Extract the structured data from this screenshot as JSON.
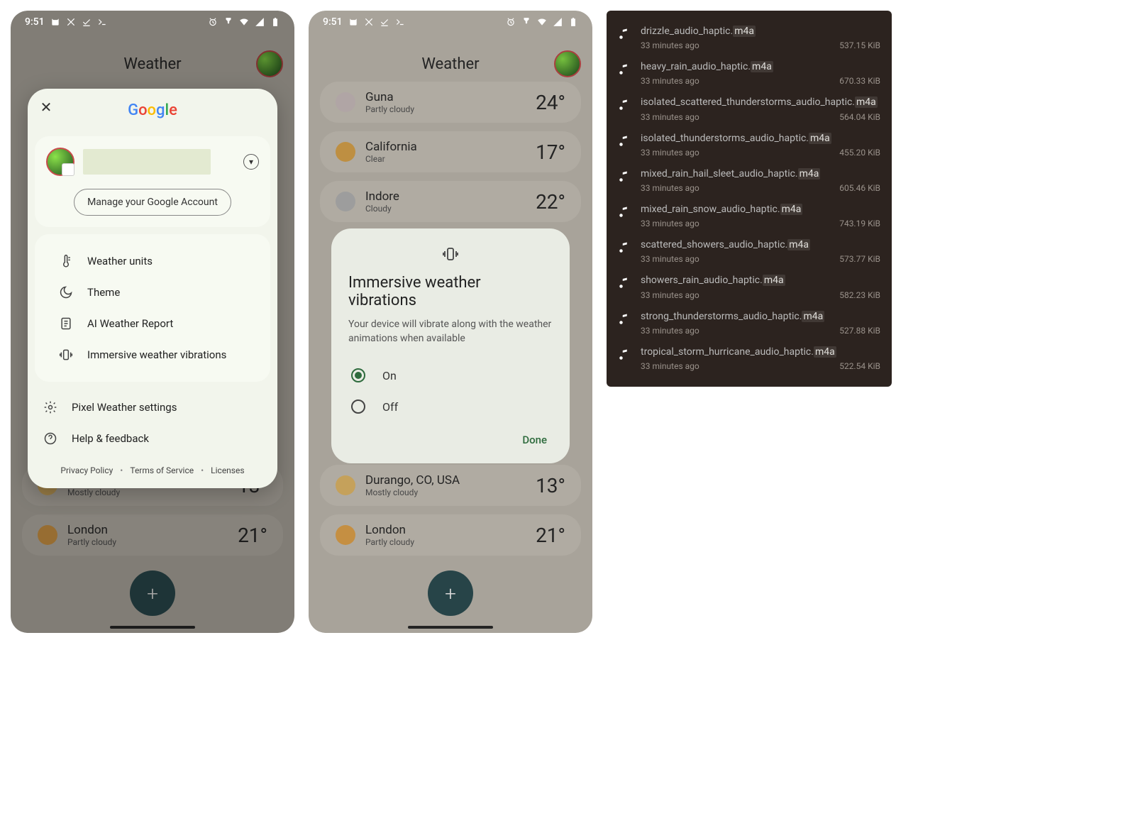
{
  "statusbar": {
    "time": "9:51"
  },
  "weather": {
    "title": "Weather",
    "locations": {
      "guna": {
        "name": "Guna",
        "cond": "Partly cloudy",
        "temp": "24°",
        "color": "#cfc2c2"
      },
      "california": {
        "name": "California",
        "cond": "Clear",
        "temp": "17°",
        "color": "#e0a84e"
      },
      "indore": {
        "name": "Indore",
        "cond": "Cloudy",
        "temp": "22°",
        "color": "#b9b9b9"
      },
      "durango": {
        "name": "Durango, CO, USA",
        "cond": "Mostly cloudy",
        "temp": "13°",
        "color": "#e8be6b"
      },
      "london": {
        "name": "London",
        "cond": "Partly cloudy",
        "temp": "21°",
        "color": "#e8a84e"
      }
    }
  },
  "account": {
    "logo": [
      "G",
      "o",
      "o",
      "g",
      "l",
      "e"
    ],
    "manage": "Manage your Google Account",
    "menu": {
      "units": "Weather units",
      "theme": "Theme",
      "ai": "AI Weather Report",
      "vibe": "Immersive weather vibrations",
      "settings": "Pixel Weather settings",
      "help": "Help & feedback"
    },
    "footer": {
      "privacy": "Privacy Policy",
      "tos": "Terms of Service",
      "licenses": "Licenses"
    }
  },
  "dialog": {
    "title": "Immersive weather vibrations",
    "body": "Your device will vibrate along with the weather animations when available",
    "on": "On",
    "off": "Off",
    "done": "Done"
  },
  "files": [
    {
      "name": "drizzle_audio_haptic.",
      "ext": "m4a",
      "age": "33 minutes ago",
      "size": "537.15  KiB"
    },
    {
      "name": "heavy_rain_audio_haptic.",
      "ext": "m4a",
      "age": "33 minutes ago",
      "size": "670.33  KiB"
    },
    {
      "name": "isolated_scattered_thunderstorms_audio_haptic.",
      "ext": "m4a",
      "age": "33 minutes ago",
      "size": "564.04  KiB"
    },
    {
      "name": "isolated_thunderstorms_audio_haptic.",
      "ext": "m4a",
      "age": "33 minutes ago",
      "size": "455.20  KiB"
    },
    {
      "name": "mixed_rain_hail_sleet_audio_haptic.",
      "ext": "m4a",
      "age": "33 minutes ago",
      "size": "605.46  KiB"
    },
    {
      "name": "mixed_rain_snow_audio_haptic.",
      "ext": "m4a",
      "age": "33 minutes ago",
      "size": "743.19  KiB"
    },
    {
      "name": "scattered_showers_audio_haptic.",
      "ext": "m4a",
      "age": "33 minutes ago",
      "size": "573.77  KiB"
    },
    {
      "name": "showers_rain_audio_haptic.",
      "ext": "m4a",
      "age": "33 minutes ago",
      "size": "582.23  KiB"
    },
    {
      "name": "strong_thunderstorms_audio_haptic.",
      "ext": "m4a",
      "age": "33 minutes ago",
      "size": "527.88  KiB"
    },
    {
      "name": "tropical_storm_hurricane_audio_haptic.",
      "ext": "m4a",
      "age": "33 minutes ago",
      "size": "522.54  KiB"
    }
  ]
}
